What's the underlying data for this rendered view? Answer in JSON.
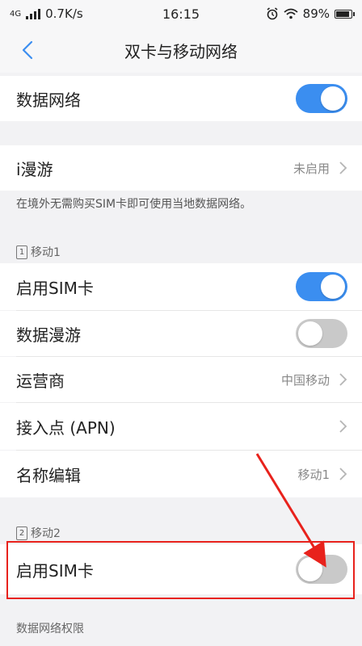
{
  "status_bar": {
    "network": "4G",
    "speed": "0.7K/s",
    "time": "16:15",
    "battery": "89%",
    "battery_level": 0.89
  },
  "nav": {
    "title": "双卡与移动网络"
  },
  "rows": {
    "data_network": {
      "label": "数据网络",
      "enabled": true
    },
    "iroaming": {
      "label": "i漫游",
      "value": "未启用"
    },
    "iroaming_hint": "在境外无需购买SIM卡即可使用当地数据网络。"
  },
  "sim1": {
    "header": "移动1",
    "slot": "1",
    "enable_sim": {
      "label": "启用SIM卡",
      "enabled": true
    },
    "data_roaming": {
      "label": "数据漫游",
      "enabled": false
    },
    "carrier": {
      "label": "运营商",
      "value": "中国移动"
    },
    "apn": {
      "label": "接入点 (APN)"
    },
    "name_edit": {
      "label": "名称编辑",
      "value": "移动1"
    }
  },
  "sim2": {
    "header": "移动2",
    "slot": "2",
    "enable_sim": {
      "label": "启用SIM卡",
      "enabled": false
    }
  },
  "bottom_header": "数据网络权限",
  "colors": {
    "accent": "#3b8ef0",
    "highlight": "#e8221c"
  }
}
